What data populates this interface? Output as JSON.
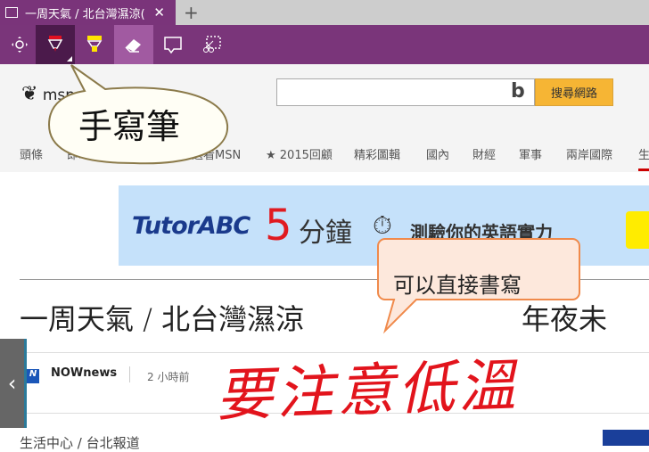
{
  "browser": {
    "tab_title": "一周天氣 / 北台灣濕涼(",
    "close": "✕",
    "new_tab": "+"
  },
  "toolbar": {
    "tools": [
      {
        "name": "touch-write",
        "icon": "⟡"
      },
      {
        "name": "pen",
        "icon": "▼"
      },
      {
        "name": "highlighter",
        "icon": "▼"
      },
      {
        "name": "eraser",
        "icon": "◇"
      },
      {
        "name": "add-note",
        "icon": "💬"
      },
      {
        "name": "clip",
        "icon": "✂"
      }
    ],
    "accent": "#7a357a"
  },
  "header": {
    "logo": "msn",
    "search_placeholder": "",
    "bing_icon": "b",
    "search_button": "搜尋網路"
  },
  "nav": [
    "頭條",
    "即時",
    "選看MSN",
    "★ 2015回顧",
    "精彩圖輯",
    "國內",
    "財經",
    "軍事",
    "兩岸國際",
    "生"
  ],
  "ad": {
    "brand": "TutorABC",
    "number": "5",
    "minutes": "分鐘",
    "clock": "⏱",
    "text": "測驗你的英語實力"
  },
  "article": {
    "headline_start": "一周天氣 / 北台灣濕涼",
    "headline_end": "年夜未",
    "source": "NOWnews",
    "source_logo": "N",
    "time": "2 小時前",
    "category": "生活中心 / 台北報道"
  },
  "side_button": "‹",
  "annotations": {
    "handwriting": "要注意低溫",
    "bubble_label": "手寫筆",
    "callout": "可以直接書寫"
  }
}
